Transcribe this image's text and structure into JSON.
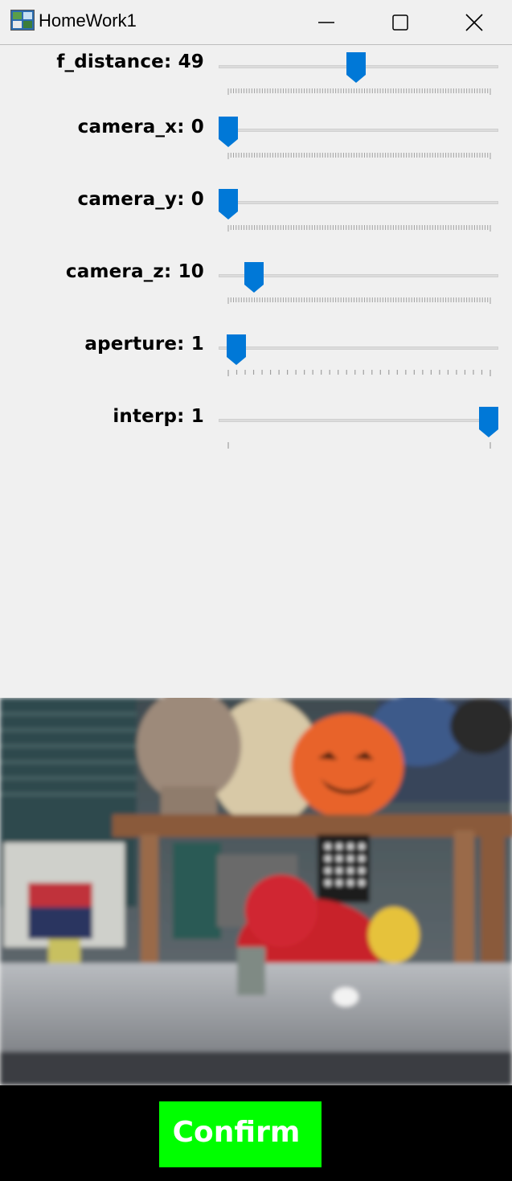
{
  "window": {
    "title": "HomeWork1",
    "controls": [
      "minimize-icon",
      "maximize-icon",
      "close-icon"
    ]
  },
  "sliders": [
    {
      "name": "f_distance",
      "label": "f_distance: 49",
      "value": 49,
      "fraction": 0.49,
      "ticks": "dense"
    },
    {
      "name": "camera_x",
      "label": "camera_x: 0",
      "value": 0,
      "fraction": 0.0,
      "ticks": "dense"
    },
    {
      "name": "camera_y",
      "label": "camera_y: 0",
      "value": 0,
      "fraction": 0.0,
      "ticks": "dense"
    },
    {
      "name": "camera_z",
      "label": "camera_z: 10",
      "value": 10,
      "fraction": 0.1,
      "ticks": "dense"
    },
    {
      "name": "aperture",
      "label": "aperture: 1",
      "value": 1,
      "fraction": 0.03,
      "ticks": "medium"
    },
    {
      "name": "interp",
      "label": "interp: 1",
      "value": 1,
      "fraction": 1.0,
      "ticks": "ends"
    }
  ],
  "preview": {
    "description_icon": "camera-preview-image"
  },
  "confirm": {
    "label": "Confirm"
  },
  "colors": {
    "accent": "#0078d7",
    "confirm_bg": "#00ff00",
    "background": "#f0f0f0"
  }
}
